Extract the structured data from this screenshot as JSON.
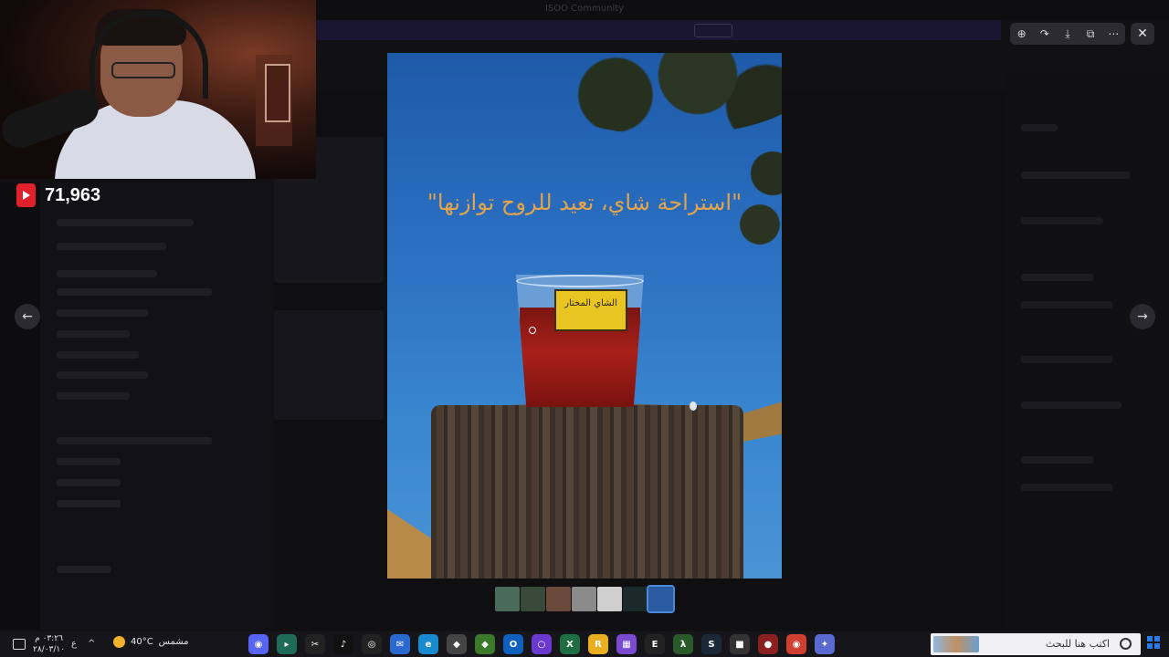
{
  "app_window": {
    "title": "ISOO Community"
  },
  "stream_overlay": {
    "viewer_count": "71,963",
    "platform_icon": "youtube-icon"
  },
  "media_viewer": {
    "toolbar": {
      "zoom_icon": "zoom-icon",
      "forward_icon": "forward-icon",
      "download_icon": "download-icon",
      "open_icon": "open-external-icon",
      "more_icon": "more-icon"
    },
    "close_label": "✕",
    "prev_label": "←",
    "next_label": "→",
    "image": {
      "quote": "\"استراحة شاي، تعيد للروح توازنها\"",
      "cup_label": "الشاي المختار"
    },
    "thumbnails": [
      {
        "color": "#4a6a5a"
      },
      {
        "color": "#3a4a3a"
      },
      {
        "color": "#6a4a3a"
      },
      {
        "color": "#8a8a8a"
      },
      {
        "color": "#cfcfcf"
      },
      {
        "color": "#1a2a2a"
      },
      {
        "color": "#2a5aa0"
      }
    ],
    "active_thumbnail_index": 6
  },
  "taskbar": {
    "search_placeholder": "اكتب هنا للبحث",
    "weather_temp": "40°C",
    "weather_text": "مشمس",
    "clock_time": "٠٣:٢٦ م",
    "clock_date": "٢٨/٠٣/١٠",
    "language": "ع",
    "apps": [
      {
        "name": "discord-icon",
        "color": "#5865f2",
        "glyph": "◉"
      },
      {
        "name": "app-icon-2",
        "color": "#1f6b5a",
        "glyph": "▸"
      },
      {
        "name": "capcut-icon",
        "color": "#222",
        "glyph": "✂"
      },
      {
        "name": "tiktok-icon",
        "color": "#111",
        "glyph": "♪"
      },
      {
        "name": "obs-icon",
        "color": "#222",
        "glyph": "◎"
      },
      {
        "name": "mail-icon",
        "color": "#2a6ad0",
        "glyph": "✉"
      },
      {
        "name": "edge-icon",
        "color": "#1a8ad0",
        "glyph": "e"
      },
      {
        "name": "app-icon-8",
        "color": "#444",
        "glyph": "◆"
      },
      {
        "name": "app-icon-9",
        "color": "#3a7a2a",
        "glyph": "◆"
      },
      {
        "name": "outlook-icon",
        "color": "#1060c0",
        "glyph": "O"
      },
      {
        "name": "app-icon-11",
        "color": "#6a3ad0",
        "glyph": "○"
      },
      {
        "name": "excel-icon",
        "color": "#1d6f42",
        "glyph": "X"
      },
      {
        "name": "rockstar-icon",
        "color": "#e8b020",
        "glyph": "R"
      },
      {
        "name": "app-icon-14",
        "color": "#7a4ad0",
        "glyph": "▦"
      },
      {
        "name": "epic-icon",
        "color": "#222",
        "glyph": "E"
      },
      {
        "name": "app-icon-16",
        "color": "#2a5a2a",
        "glyph": "λ"
      },
      {
        "name": "steam-icon",
        "color": "#1b2838",
        "glyph": "S"
      },
      {
        "name": "app-icon-18",
        "color": "#333",
        "glyph": "■"
      },
      {
        "name": "app-icon-19",
        "color": "#8a2020",
        "glyph": "●"
      },
      {
        "name": "chrome-icon",
        "color": "#d04030",
        "glyph": "◉"
      },
      {
        "name": "copilot-icon",
        "color": "#5a6ad0",
        "glyph": "✦"
      }
    ]
  }
}
